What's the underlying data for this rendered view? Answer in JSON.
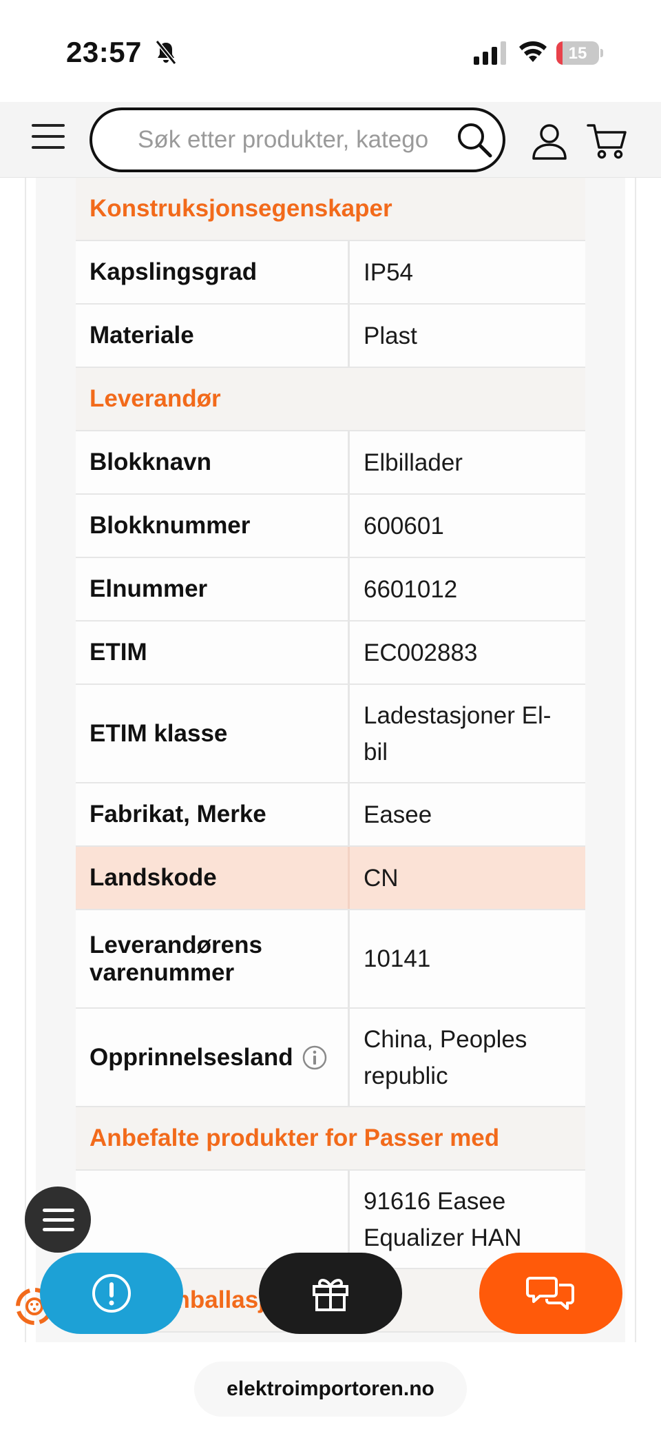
{
  "status_bar": {
    "time": "23:57",
    "battery_level": "15",
    "battery_fraction": 0.15
  },
  "header": {
    "search_placeholder": "Søk etter produkter, katego"
  },
  "table": {
    "sections": [
      {
        "title": "Konstruksjonsegenskaper",
        "rows": [
          {
            "key": "Kapslingsgrad",
            "value": "IP54"
          },
          {
            "key": "Materiale",
            "value": "Plast"
          }
        ]
      },
      {
        "title": "Leverandør",
        "rows": [
          {
            "key": "Blokknavn",
            "value": "Elbillader"
          },
          {
            "key": "Blokknummer",
            "value": "600601"
          },
          {
            "key": "Elnummer",
            "value": "6601012"
          },
          {
            "key": "ETIM",
            "value": "EC002883"
          },
          {
            "key": "ETIM klasse",
            "value": "Ladestasjoner El-bil"
          },
          {
            "key": "Fabrikat, Merke",
            "value": "Easee"
          },
          {
            "key": "Landskode",
            "value": "CN"
          },
          {
            "key": "Leverandørens varenummer",
            "value": "10141"
          },
          {
            "key": "Opprinnelsesland",
            "value": "China, Peoples republic"
          }
        ]
      },
      {
        "title": "Anbefalte produkter for Passer med",
        "rows": [
          {
            "key": "",
            "value": "91616 Easee Equalizer HAN"
          }
        ]
      },
      {
        "title": "Pakk/Emballasje",
        "rows": []
      }
    ]
  },
  "browser": {
    "url": "elektroimportoren.no"
  },
  "colors": {
    "accent_orange": "#f26a1b",
    "chat_button": "#ff5a0a",
    "alert_button": "#1da1d6",
    "gift_button": "#1c1c1c",
    "highlight_row": "#fbe2d6"
  },
  "icons": {
    "menu": "hamburger-icon",
    "search": "search-icon",
    "account": "user-icon",
    "cart": "cart-icon",
    "info": "info-icon",
    "alert": "exclamation-icon",
    "gift": "gift-icon",
    "chat": "chat-bubbles-icon"
  }
}
